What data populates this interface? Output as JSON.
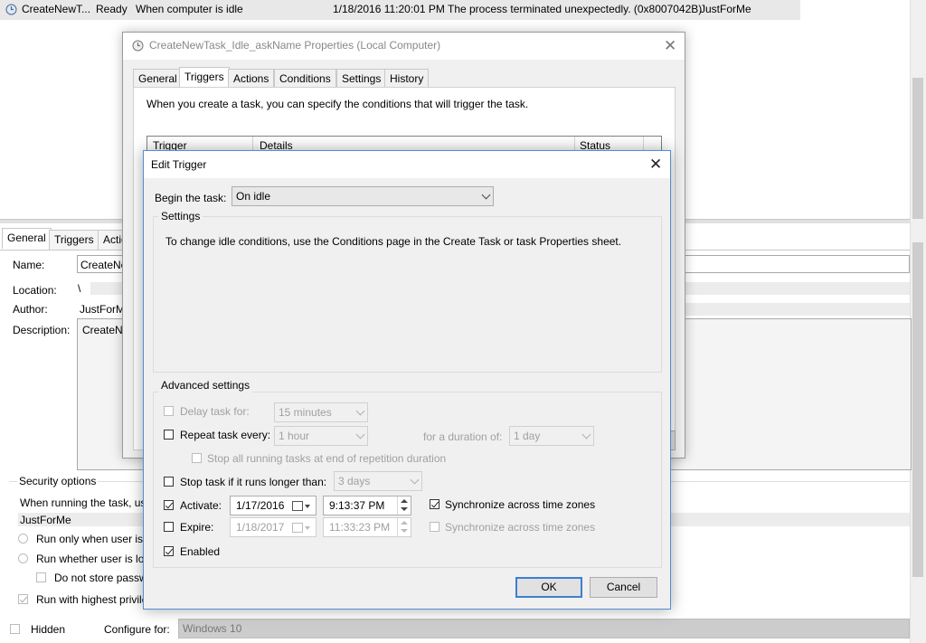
{
  "task_list": {
    "row": {
      "name": "CreateNewT...",
      "status": "Ready",
      "trigger": "When computer is idle",
      "next_run": "1/18/2016 11:20:01 PM",
      "last_result": "The process terminated unexpectedly. (0x8007042B)",
      "author": "JustForMe"
    }
  },
  "details_panel": {
    "tabs": [
      "General",
      "Triggers",
      "Actio"
    ],
    "name_label": "Name:",
    "name_value": "CreateNe",
    "location_label": "Location:",
    "location_value": "\\",
    "author_label": "Author:",
    "author_value": "JustForM",
    "description_label": "Description:",
    "description_value": "CreateNe",
    "security_title": "Security options",
    "running_as_label": "When running the task, us",
    "user_account": "JustForMe",
    "run_only_logged_on": "Run only when user is l",
    "run_whether_logged_on": "Run whether user is log",
    "dont_store_password": "Do not store passw",
    "run_highest_privileges": "Run with highest privile",
    "hidden_label": "Hidden",
    "configure_for_label": "Configure for:",
    "configure_for_value": "Windows 10"
  },
  "properties_dialog": {
    "title": "CreateNewTask_Idle_askName Properties (Local Computer)",
    "tabs": [
      "General",
      "Triggers",
      "Actions",
      "Conditions",
      "Settings",
      "History"
    ],
    "description": "When you create a task, you can specify the conditions that will trigger the task.",
    "columns": [
      "Trigger",
      "Details",
      "Status"
    ]
  },
  "edit_trigger": {
    "title": "Edit Trigger",
    "begin_label": "Begin the task:",
    "begin_value": "On idle",
    "settings_title": "Settings",
    "settings_text": "To change idle conditions, use the Conditions page in the Create Task or task Properties sheet.",
    "advanced_title": "Advanced settings",
    "delay_label": "Delay task for:",
    "delay_value": "15 minutes",
    "repeat_label": "Repeat task every:",
    "repeat_value": "1 hour",
    "duration_label": "for a duration of:",
    "duration_value": "1 day",
    "stop_all_label": "Stop all running tasks at end of repetition duration",
    "stop_longer_label": "Stop task if it runs longer than:",
    "stop_longer_value": "3 days",
    "activate_label": "Activate:",
    "activate_date": "1/17/2016",
    "activate_time": "9:13:37 PM",
    "sync_activate_label": "Synchronize across time zones",
    "expire_label": "Expire:",
    "expire_date": "1/18/2017",
    "expire_time": "11:33:23 PM",
    "sync_expire_label": "Synchronize across time zones",
    "enabled_label": "Enabled",
    "ok_label": "OK",
    "cancel_label": "Cancel"
  },
  "colors": {
    "accent": "#3c7fd0",
    "dialog_bg": "#f0f0f0",
    "disabled_text": "#a0a0a0"
  }
}
